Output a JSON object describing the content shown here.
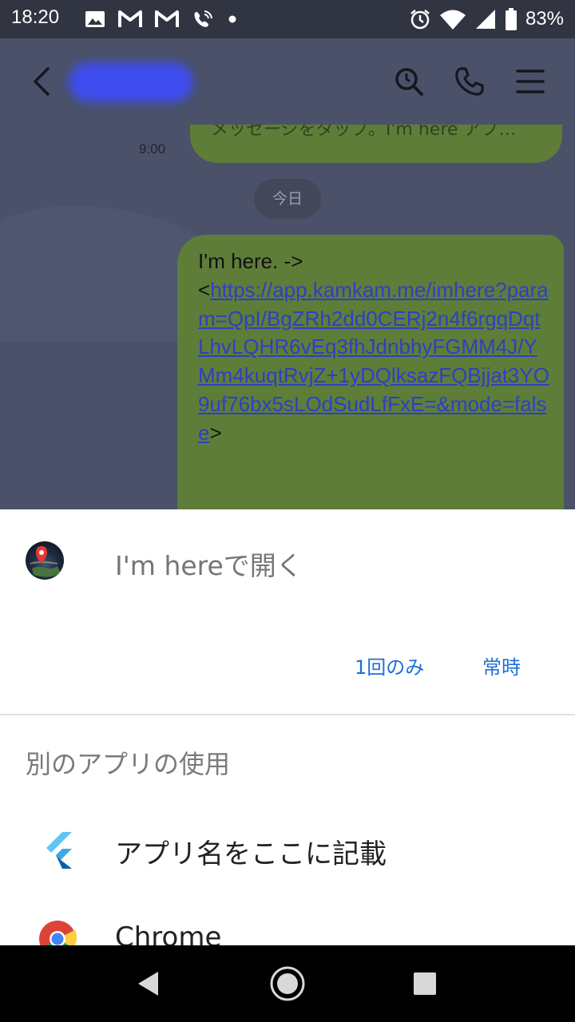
{
  "status_bar": {
    "time": "18:20",
    "battery_percent": "83%",
    "notification_icons": [
      "image-icon",
      "gmail-icon",
      "gmail-icon",
      "wifi-calling-icon",
      "dot-icon"
    ],
    "system_icons": [
      "alarm-icon",
      "wifi-icon",
      "signal-icon",
      "battery-icon"
    ]
  },
  "chat": {
    "previous_message_text": "メッセージをタップ。I'm here アプ…",
    "previous_message_time": "9:00",
    "date_separator": "今日",
    "message_prefix": "I'm here.  ->",
    "message_open_bracket": "<",
    "message_link": "https://app.kamkam.me/imhere?param=QpI/BgZRh2dd0CERj2n4f6rgqDqtLhvLQHR6vEq3fhJdnbhyFGMM4J/YMm4kuqtRvjZ+1yDQlksazFQBjjat3YO9uf76bx5sLOdSudLfFxE=&mode=false",
    "message_close_bracket": ">"
  },
  "sheet": {
    "open_with_title": "I'm hereで開く",
    "just_once_label": "1回のみ",
    "always_label": "常時",
    "other_apps_title": "別のアプリの使用",
    "apps": [
      {
        "label": "アプリ名をここに記載",
        "icon": "flutter-icon"
      },
      {
        "label": "Chrome",
        "icon": "chrome-icon"
      }
    ]
  },
  "colors": {
    "chat_background": "#4a5169",
    "bubble": "#5e7d39",
    "link": "#2f3fc6",
    "accent": "#1e6fd8"
  }
}
